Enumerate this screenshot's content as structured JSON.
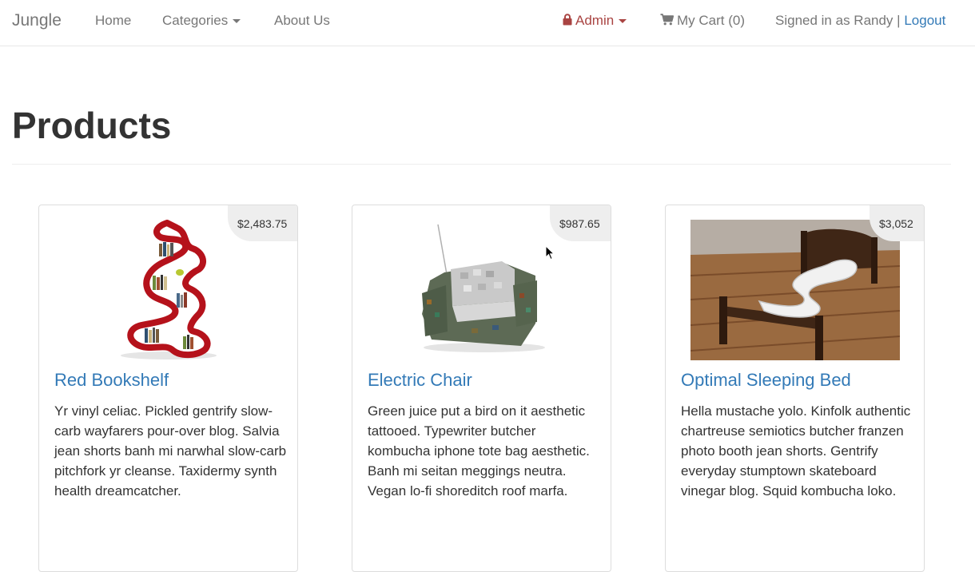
{
  "navbar": {
    "brand": "Jungle",
    "home": "Home",
    "categories": "Categories",
    "about": "About Us",
    "admin": "Admin",
    "cart": "My Cart (0)",
    "signed_in": "Signed in as Randy",
    "separator": "|",
    "logout": "Logout"
  },
  "page": {
    "title": "Products"
  },
  "products": [
    {
      "name": "Red Bookshelf",
      "price": "$2,483.75",
      "description": "Yr vinyl celiac. Pickled gentrify slow-carb wayfarers pour-over blog. Salvia jean shorts banh mi narwhal slow-carb pitchfork yr cleanse. Taxidermy synth health dreamcatcher."
    },
    {
      "name": "Electric Chair",
      "price": "$987.65",
      "description": "Green juice put a bird on it aesthetic tattooed. Typewriter butcher kombucha iphone tote bag aesthetic. Banh mi seitan meggings neutra. Vegan lo-fi shoreditch roof marfa."
    },
    {
      "name": "Optimal Sleeping Bed",
      "price": "$3,052",
      "description": "Hella mustache yolo. Kinfolk authentic chartreuse semiotics butcher franzen photo booth jean shorts. Gentrify everyday stumptown skateboard vinegar blog. Squid kombucha loko."
    }
  ],
  "colors": {
    "link": "#337ab7",
    "admin": "#a94442",
    "nav_text": "#777777",
    "price_bg": "#eeeeee"
  },
  "icons": {
    "admin": "lock-icon",
    "cart": "shopping-cart-icon",
    "dropdown": "caret-down-icon"
  }
}
